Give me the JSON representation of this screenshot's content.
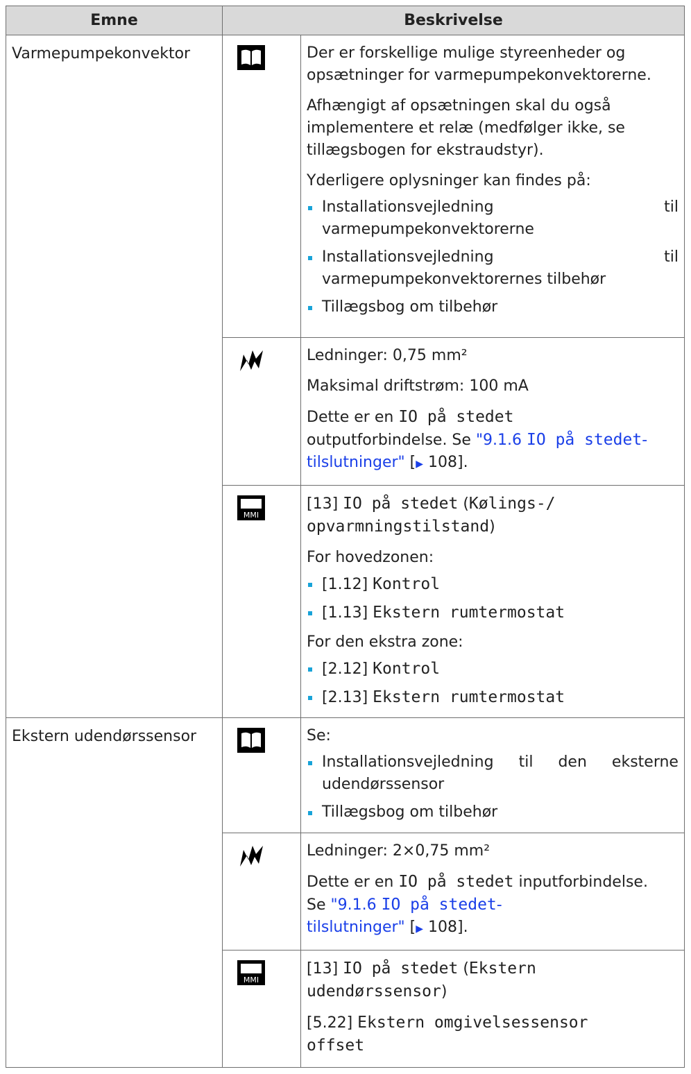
{
  "header": {
    "col1": "Emne",
    "col2": "Beskrivelse"
  },
  "rows": [
    {
      "topic": "Varmepumpekonvektor",
      "book": {
        "p1": "Der er forskellige mulige styreenheder og opsætninger for varmepumpekonvektorerne.",
        "p2": "Afhængigt af opsætningen skal du også implementere et relæ (medfølger ikke, se tillægsbogen for ekstraudstyr).",
        "p3": "Yderligere oplysninger kan findes på:",
        "b1a": "Installationsvejledning",
        "b1b": "til",
        "b1c": "varmepumpekonvektorerne",
        "b2a": "Installationsvejledning",
        "b2b": "til",
        "b2c": "varmepumpekonvektorernes tilbehør",
        "b3": "Tillægsbog om tilbehør"
      },
      "wiring": {
        "p1": "Ledninger: 0,75 mm²",
        "p2": "Maksimal driftstrøm: 100 mA",
        "p3a": "Dette er en ",
        "p3mono": "IO på stedet",
        "p3b": "outputforbindelse. Se ",
        "link_q1": "\"9.1.6 ",
        "link_mono": "IO på stedet",
        "link_rest": "-tilslutninger\"",
        "page_ref_open": " [",
        "page_arrow": "▶",
        "page_ref": " 108].",
        "link_line2_a": "\"9.1.6 ",
        "link_line2_b": "tilslutninger\""
      },
      "mmi": {
        "l1": "[13] ",
        "l1mono": "IO på stedet",
        "l1b": " (",
        "l1mono2": "Kølings-/",
        "l2mono": "opvarmningstilstand",
        "l2b": ")",
        "main_zone": "For hovedzonen:",
        "m1a": "[1.12] ",
        "m1b": "Kontrol",
        "m2a": "[1.13] ",
        "m2b": "Ekstern rumtermostat",
        "extra_zone": "For den ekstra zone:",
        "e1a": "[2.12] ",
        "e1b": "Kontrol",
        "e2a": "[2.13] ",
        "e2b": "Ekstern rumtermostat"
      }
    },
    {
      "topic": "Ekstern udendørssensor",
      "book": {
        "p1": "Se:",
        "b1a": "Installationsvejledning",
        "b1b": "til",
        "b1c": "den",
        "b1d": "eksterne",
        "b1e": "udendørssensor",
        "b2": "Tillægsbog om tilbehør"
      },
      "wiring": {
        "p1": "Ledninger: 2×0,75 mm²",
        "p2a": "Dette er en ",
        "p2mono": "IO på stedet",
        "p2b": " inputforbindelse.",
        "p3a": "Se ",
        "link_q": "\"9.1.6 ",
        "link_mono": "IO på stedet",
        "link_dash": "-",
        "link_line2": "tilslutninger\"",
        "page_ref_open": " [",
        "page_arrow": "▶",
        "page_ref": " 108]."
      },
      "mmi": {
        "l1": "[13] ",
        "l1mono": "IO på stedet",
        "l1b": " (",
        "l1mono2": "Ekstern",
        "l2mono": "udendørssensor",
        "l2b": ")",
        "p2a": "[5.22] ",
        "p2mono": "Ekstern omgivelsessensor",
        "p2mono2": "offset"
      }
    }
  ]
}
